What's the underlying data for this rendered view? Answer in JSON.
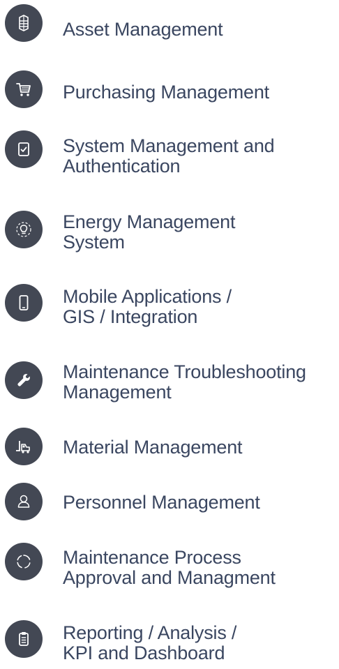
{
  "menu": {
    "items": [
      {
        "icon": "database-icon",
        "lines": [
          "Asset Management"
        ]
      },
      {
        "icon": "shopping-cart-icon",
        "lines": [
          "Purchasing Management"
        ]
      },
      {
        "icon": "document-check-icon",
        "lines": [
          "System Management and",
          "Authentication"
        ]
      },
      {
        "icon": "lightbulb-icon",
        "lines": [
          "Energy Management",
          "System"
        ]
      },
      {
        "icon": "mobile-phone-icon",
        "lines": [
          "Mobile Applications /",
          "GIS / Integration"
        ]
      },
      {
        "icon": "wrench-icon",
        "lines": [
          "Maintenance Troubleshooting",
          "Management"
        ]
      },
      {
        "icon": "forklift-icon",
        "lines": [
          "Material Management"
        ]
      },
      {
        "icon": "user-icon",
        "lines": [
          "Personnel Management"
        ]
      },
      {
        "icon": "process-cycle-icon",
        "lines": [
          "Maintenance Process",
          "Approval and Managment"
        ]
      },
      {
        "icon": "clipboard-icon",
        "lines": [
          "Reporting / Analysis /",
          "KPI and Dashboard"
        ]
      }
    ]
  },
  "colors": {
    "icon_background": "#434854",
    "text": "#3a4660"
  }
}
